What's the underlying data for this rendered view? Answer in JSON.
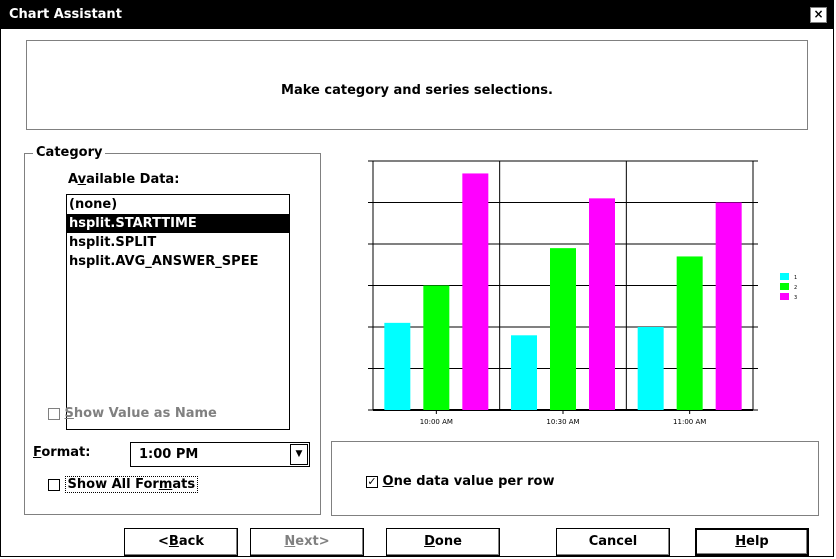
{
  "window": {
    "title": "Chart Assistant",
    "close_glyph": "×"
  },
  "header": {
    "instruction": "Make category and series selections."
  },
  "category": {
    "group_label": "Category",
    "available_label_pre": "A",
    "available_label_mn": "v",
    "available_label_post": "ailable Data:",
    "items": [
      {
        "label": "(none)"
      },
      {
        "label": "hsplit.STARTTIME",
        "selected": true
      },
      {
        "label": "hsplit.SPLIT"
      },
      {
        "label": "hsplit.AVG_ANSWER_SPEE"
      }
    ],
    "show_value_as_name": {
      "mn": "S",
      "rest": "how Value as Name",
      "checked": false,
      "enabled": false
    },
    "format_mn": "F",
    "format_rest": "ormat:",
    "format_value": "1:00 PM",
    "show_all_formats": {
      "pre": "Show All For",
      "mn": "m",
      "post": "ats",
      "checked": false
    }
  },
  "options": {
    "one_value_per_row": {
      "mn": "O",
      "rest": "ne data value per row",
      "checked": true
    }
  },
  "buttons": {
    "back": {
      "pre": "<",
      "mn": "B",
      "post": "ack"
    },
    "next": {
      "pre": "",
      "mn": "N",
      "post": "ext>"
    },
    "done": {
      "pre": "",
      "mn": "D",
      "post": "one"
    },
    "cancel": {
      "pre": "Cancel",
      "mn": "",
      "post": ""
    },
    "help": {
      "pre": "",
      "mn": "H",
      "post": "elp"
    }
  },
  "chart_data": {
    "type": "bar",
    "categories": [
      "10:00 AM",
      "10:30 AM",
      "11:00 AM"
    ],
    "series": [
      {
        "name": "1",
        "color": "#00ffff",
        "values": [
          2.1,
          1.8,
          2.0
        ]
      },
      {
        "name": "2",
        "color": "#00ff00",
        "values": [
          3.0,
          3.9,
          3.7
        ]
      },
      {
        "name": "3",
        "color": "#ff00ff",
        "values": [
          5.7,
          5.1,
          5.0
        ]
      }
    ],
    "ylim": [
      0,
      6
    ],
    "grid": true,
    "legend_position": "right"
  }
}
